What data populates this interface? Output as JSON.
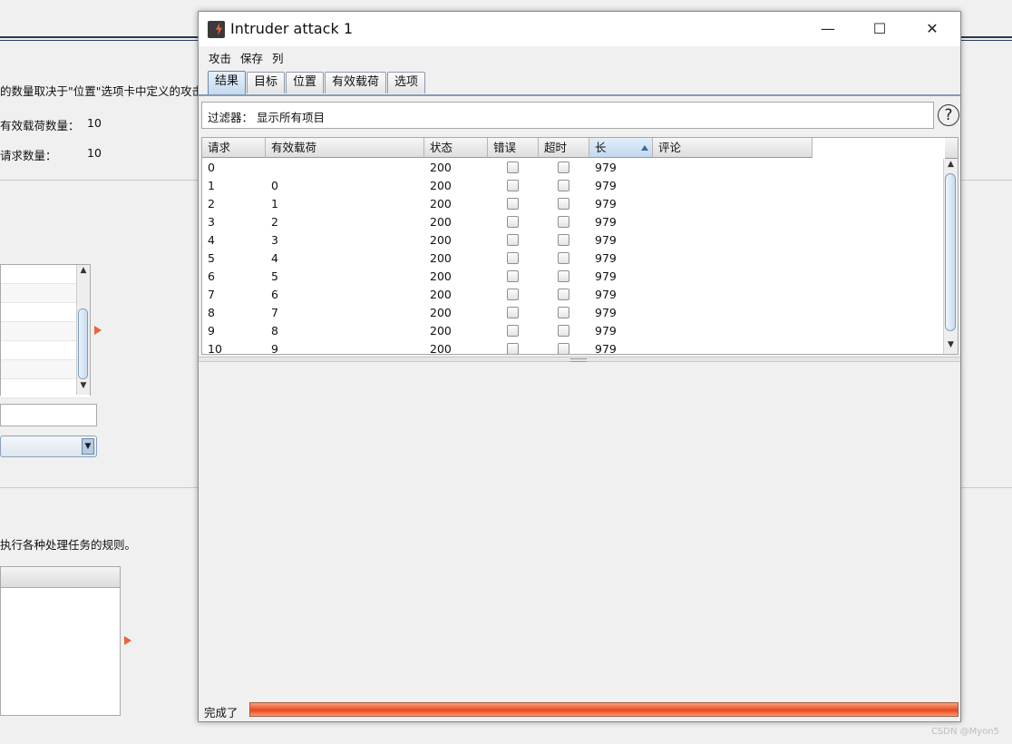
{
  "background": {
    "text_positions_desc": "的数量取决于\"位置\"选项卡中定义的攻击",
    "payload_count_label": "有效载荷数量：",
    "payload_count_value": "10",
    "request_count_label": "请求数量：",
    "request_count_value": "10",
    "rules_text": "执行各种处理任务的规则。"
  },
  "window": {
    "title": "Intruder attack 1",
    "controls": {
      "minimize": "—",
      "maximize": "☐",
      "close": "✕"
    }
  },
  "menu": [
    "攻击",
    "保存",
    "列"
  ],
  "tabs": [
    "结果",
    "目标",
    "位置",
    "有效载荷",
    "选项"
  ],
  "active_tab": "结果",
  "filter": {
    "text": "过滤器：  显示所有项目"
  },
  "table": {
    "columns": [
      "请求",
      "有效载荷",
      "状态",
      "错误",
      "超时",
      "长",
      "评论"
    ],
    "sorted_column": "长",
    "rows": [
      {
        "request": "0",
        "payload": "",
        "status": "200",
        "length": "979"
      },
      {
        "request": "1",
        "payload": "0",
        "status": "200",
        "length": "979"
      },
      {
        "request": "2",
        "payload": "1",
        "status": "200",
        "length": "979"
      },
      {
        "request": "3",
        "payload": "2",
        "status": "200",
        "length": "979"
      },
      {
        "request": "4",
        "payload": "3",
        "status": "200",
        "length": "979"
      },
      {
        "request": "5",
        "payload": "4",
        "status": "200",
        "length": "979"
      },
      {
        "request": "6",
        "payload": "5",
        "status": "200",
        "length": "979"
      },
      {
        "request": "7",
        "payload": "6",
        "status": "200",
        "length": "979"
      },
      {
        "request": "8",
        "payload": "7",
        "status": "200",
        "length": "979"
      },
      {
        "request": "9",
        "payload": "8",
        "status": "200",
        "length": "979"
      },
      {
        "request": "10",
        "payload": "9",
        "status": "200",
        "length": "979"
      }
    ]
  },
  "status": {
    "label": "完成了",
    "progress_percent": 100
  },
  "watermark": "CSDN @Myon5",
  "colors": {
    "progress": "#e64a1c",
    "accent_arrow": "#e8643a",
    "tab_active": "#c6d9ee"
  }
}
